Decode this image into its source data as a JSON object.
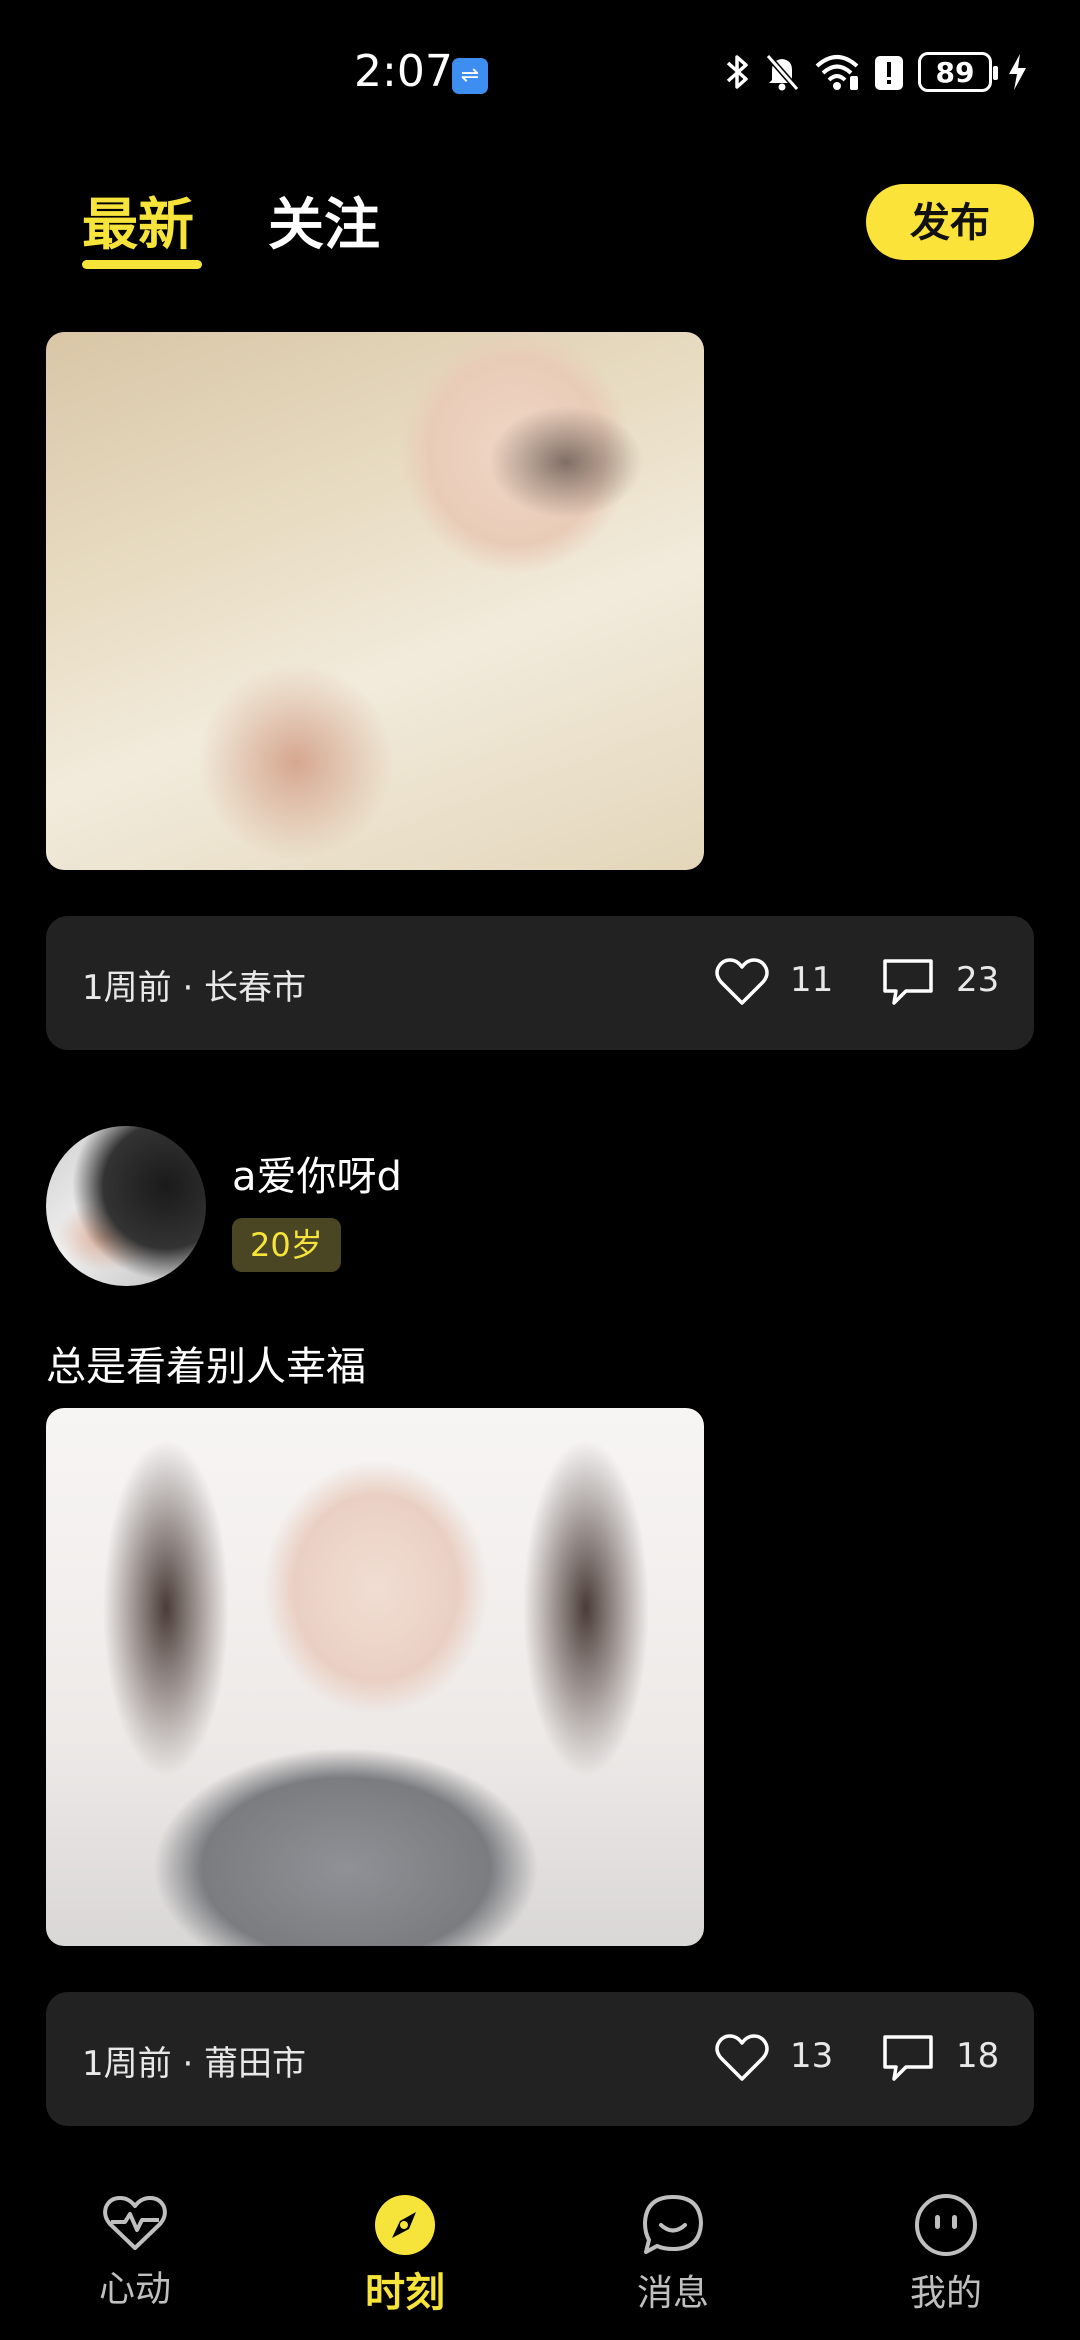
{
  "status_bar": {
    "time": "2:07",
    "battery": "89",
    "icons": [
      "usb-icon",
      "bluetooth-icon",
      "bell-off-icon",
      "wifi-icon",
      "alert-icon",
      "battery-icon",
      "charging-icon"
    ]
  },
  "header": {
    "tabs": [
      {
        "label": "最新",
        "active": true
      },
      {
        "label": "关注",
        "active": false
      }
    ],
    "publish_label": "发布",
    "accent_color": "#f7e43a"
  },
  "posts": [
    {
      "image": "photo-woman-white-top",
      "meta": "1周前 · 长春市",
      "likes": "11",
      "comments": "23"
    },
    {
      "user": {
        "name": "a爱你呀d",
        "age": "20岁",
        "avatar": "avatar-photo"
      },
      "caption": "总是看着别人幸福",
      "image": "photo-woman-grey-sweater",
      "meta": "1周前 · 莆田市",
      "likes": "13",
      "comments": "18"
    }
  ],
  "bottom_nav": [
    {
      "label": "心动",
      "icon": "heart-pulse-icon",
      "active": false
    },
    {
      "label": "时刻",
      "icon": "compass-icon",
      "active": true
    },
    {
      "label": "消息",
      "icon": "chat-bubble-icon",
      "active": false
    },
    {
      "label": "我的",
      "icon": "profile-face-icon",
      "active": false
    }
  ]
}
